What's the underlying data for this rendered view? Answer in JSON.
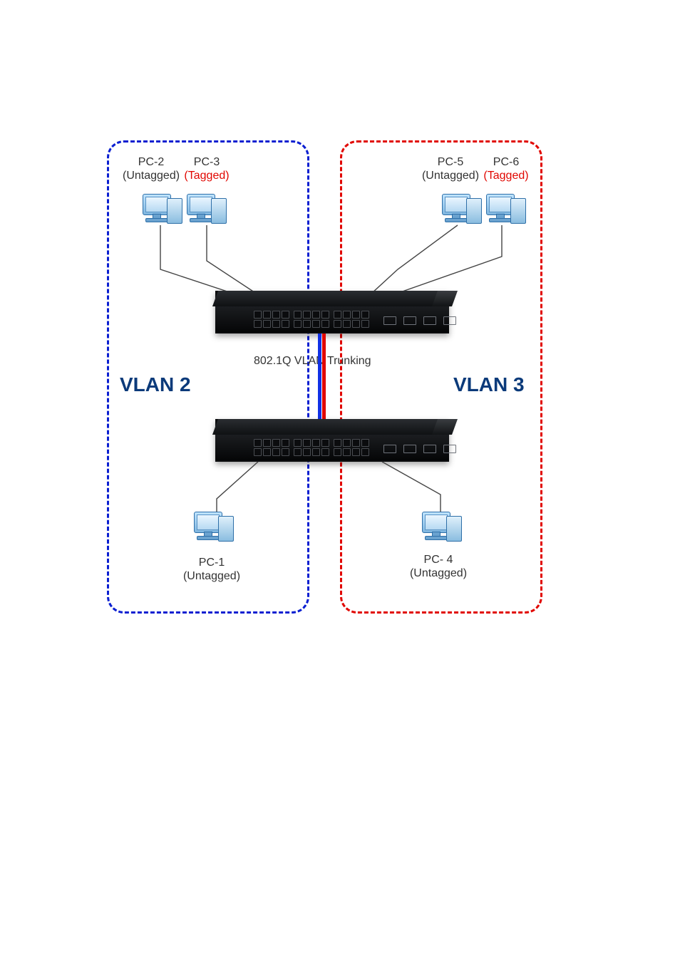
{
  "vlan2": {
    "title": "VLAN 2"
  },
  "vlan3": {
    "title": "VLAN 3"
  },
  "trunk": {
    "label": "802.1Q VLAN Trunking"
  },
  "pcs": {
    "pc1": {
      "name": "PC-1",
      "tag": "(Untagged)",
      "tag_color": "normal"
    },
    "pc2": {
      "name": "PC-2",
      "tag": "(Untagged)",
      "tag_color": "normal"
    },
    "pc3": {
      "name": "PC-3",
      "tag": "(Tagged)",
      "tag_color": "red"
    },
    "pc4": {
      "name": "PC- 4",
      "tag": "(Untagged)",
      "tag_color": "normal"
    },
    "pc5": {
      "name": "PC-5",
      "tag": "(Untagged)",
      "tag_color": "normal"
    },
    "pc6": {
      "name": "PC-6",
      "tag": "(Tagged)",
      "tag_color": "red"
    }
  },
  "chart_data": {
    "type": "diagram",
    "title": "802.1Q VLAN Trunking",
    "vlans": [
      {
        "id": 2,
        "name": "VLAN 2",
        "color": "#0b1fd1",
        "members": [
          "PC-1",
          "PC-2",
          "PC-3"
        ]
      },
      {
        "id": 3,
        "name": "VLAN 3",
        "color": "#e10600",
        "members": [
          "PC-4",
          "PC-5",
          "PC-6"
        ]
      }
    ],
    "switches": [
      {
        "id": "top",
        "ports": 24,
        "sfp": 4,
        "connected_pcs": [
          "PC-2",
          "PC-3",
          "PC-5",
          "PC-6"
        ]
      },
      {
        "id": "bottom",
        "ports": 24,
        "sfp": 4,
        "connected_pcs": [
          "PC-1",
          "PC-4"
        ]
      }
    ],
    "trunk_link": {
      "between": [
        "top",
        "bottom"
      ],
      "type": "802.1Q",
      "vlans_carried": [
        2,
        3
      ]
    },
    "pcs": [
      {
        "name": "PC-1",
        "vlan": 2,
        "tagging": "Untagged",
        "connected_to": "bottom"
      },
      {
        "name": "PC-2",
        "vlan": 2,
        "tagging": "Untagged",
        "connected_to": "top"
      },
      {
        "name": "PC-3",
        "vlan": 2,
        "tagging": "Tagged",
        "connected_to": "top"
      },
      {
        "name": "PC-4",
        "vlan": 3,
        "tagging": "Untagged",
        "connected_to": "bottom"
      },
      {
        "name": "PC-5",
        "vlan": 3,
        "tagging": "Untagged",
        "connected_to": "top"
      },
      {
        "name": "PC-6",
        "vlan": 3,
        "tagging": "Tagged",
        "connected_to": "top"
      }
    ]
  }
}
